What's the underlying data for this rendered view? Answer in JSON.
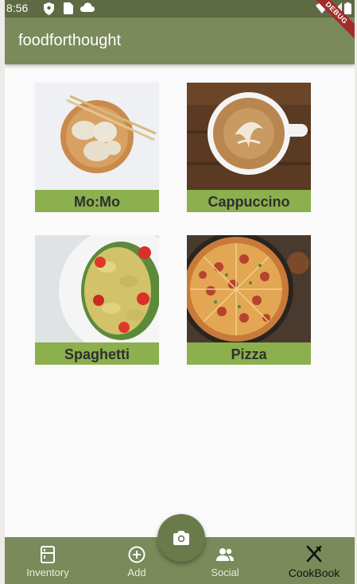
{
  "status_bar": {
    "time": "8:56",
    "left_icons": [
      "shield-icon",
      "sim-card-icon",
      "cloud-icon"
    ],
    "right_icons": [
      "wifi-icon",
      "signal-icon",
      "battery-icon"
    ]
  },
  "app_bar": {
    "title": "foodforthought"
  },
  "debug_banner": {
    "label": "DEBUG",
    "color": "#a52a2a"
  },
  "grid": {
    "items": [
      {
        "label": "Mo:Mo",
        "image": "momo-dumplings-photo"
      },
      {
        "label": "Cappuccino",
        "image": "cappuccino-latte-art-photo"
      },
      {
        "label": "Spaghetti",
        "image": "farfalle-pasta-salad-photo"
      },
      {
        "label": "Pizza",
        "image": "pepperoni-pizza-photo"
      }
    ]
  },
  "fab": {
    "icon": "camera-icon"
  },
  "bottom_nav": {
    "items": [
      {
        "label": "Inventory",
        "icon": "fridge-icon",
        "active": false
      },
      {
        "label": "Add",
        "icon": "add-circle-icon",
        "active": false
      },
      {
        "label": "Social",
        "icon": "people-icon",
        "active": false
      },
      {
        "label": "CookBook",
        "icon": "utensils-icon",
        "active": true
      }
    ]
  },
  "colors": {
    "primary": "#7b8a5a",
    "status_bar": "#5e6a44",
    "label_background": "#8bb04d",
    "fab": "#6b7a4b"
  }
}
